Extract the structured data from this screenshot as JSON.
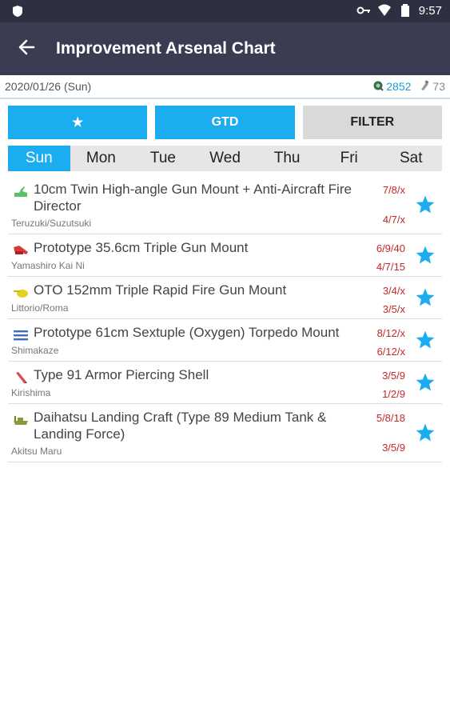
{
  "status": {
    "time": "9:57",
    "icons": [
      "app-shield-icon",
      "vpn-key-icon",
      "wifi-icon",
      "battery-icon"
    ]
  },
  "toolbar": {
    "title": "Improvement Arsenal Chart",
    "back_icon": "arrow-back-icon"
  },
  "info": {
    "date": "2020/01/26 (Sun)",
    "screws": "2852",
    "devmats": "73",
    "colors": {
      "screws": "#1aa0d8",
      "devmats": "#888888"
    }
  },
  "buttons": {
    "star_label": "★",
    "gtd_label": "GTD",
    "filter_label": "FILTER"
  },
  "days": [
    "Sun",
    "Mon",
    "Tue",
    "Wed",
    "Thu",
    "Fri",
    "Sat"
  ],
  "active_day": "Sun",
  "items": [
    {
      "name": "10cm Twin High-angle Gun Mount + Anti-Aircraft Fire Director",
      "ship": "Teruzuki/Suzutsuki",
      "cost_top": "7/8/x",
      "cost_bottom": "4/7/x",
      "icon": "high-angle-gun-icon",
      "icon_color": "#5cbf6a"
    },
    {
      "name": "Prototype 35.6cm Triple Gun Mount",
      "ship": "Yamashiro Kai Ni",
      "cost_top": "6/9/40",
      "cost_bottom": "4/7/15",
      "icon": "large-caliber-gun-icon",
      "icon_color": "#d63a3a"
    },
    {
      "name": "OTO 152mm Triple Rapid Fire Gun Mount",
      "ship": "Littorio/Roma",
      "cost_top": "3/4/x",
      "cost_bottom": "3/5/x",
      "icon": "secondary-gun-icon",
      "icon_color": "#e5d21d"
    },
    {
      "name": "Prototype 61cm Sextuple (Oxygen) Torpedo Mount",
      "ship": "Shimakaze",
      "cost_top": "8/12/x",
      "cost_bottom": "6/12/x",
      "icon": "torpedo-icon",
      "icon_color": "#3a6fb8"
    },
    {
      "name": "Type 91 Armor Piercing Shell",
      "ship": "Kirishima",
      "cost_top": "3/5/9",
      "cost_bottom": "1/2/9",
      "icon": "ap-shell-icon",
      "icon_color": "#d64c4c"
    },
    {
      "name": "Daihatsu Landing Craft (Type 89 Medium Tank & Landing Force)",
      "ship": "Akitsu Maru",
      "cost_top": "5/8/18",
      "cost_bottom": "3/5/9",
      "icon": "landing-craft-icon",
      "icon_color": "#8a9a3a"
    }
  ],
  "favorite_icon": "star-icon",
  "accent_color": "#1cadf0"
}
